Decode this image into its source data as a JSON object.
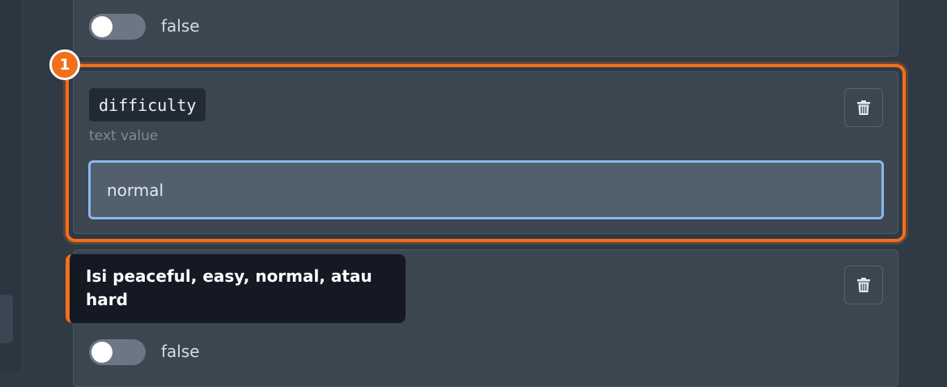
{
  "top_toggle": {
    "label": "false",
    "checked": false
  },
  "step": {
    "number": "1"
  },
  "field": {
    "key": "difficulty",
    "type_label": "text value",
    "value": "normal"
  },
  "tooltip": {
    "text": "Isi peaceful, easy, normal, atau hard"
  },
  "bottom_toggle": {
    "label": "false",
    "checked": false
  },
  "icons": {
    "delete": "trash-icon"
  },
  "colors": {
    "accent": "#f26f1a",
    "focus": "#8ab7ee",
    "card": "#3b4651"
  }
}
